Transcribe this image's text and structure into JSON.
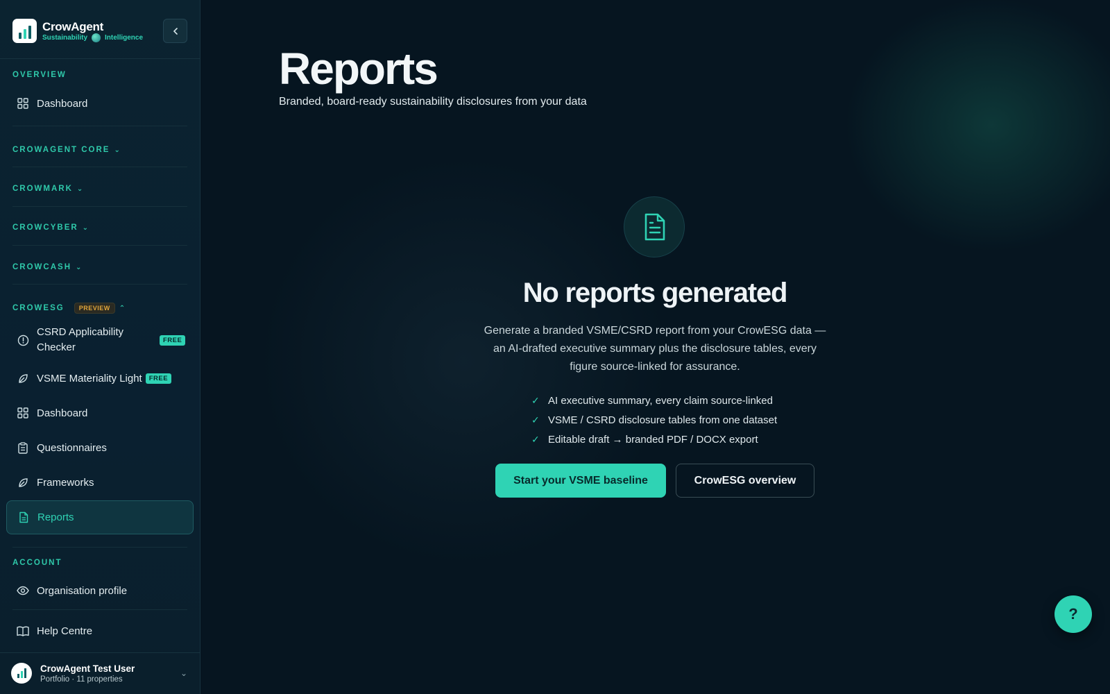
{
  "brand": {
    "name": "CrowAgent",
    "sub_left": "Sustainability",
    "sub_right": "Intelligence"
  },
  "sidebar": {
    "sections": {
      "overview": "OVERVIEW",
      "core": "CROWAGENT CORE",
      "mark": "CROWMARK",
      "cyber": "CROWCYBER",
      "cash": "CROWCASH",
      "esg": "CROWESG",
      "esg_badge": "PREVIEW",
      "account": "ACCOUNT"
    },
    "overview_dashboard": "Dashboard",
    "esg_items": {
      "csrd": "CSRD Applicability Checker",
      "csrd_badge": "FREE",
      "vsme": "VSME Materiality Light",
      "vsme_badge": "FREE",
      "dashboard": "Dashboard",
      "questionnaires": "Questionnaires",
      "frameworks": "Frameworks",
      "reports": "Reports"
    },
    "account_items": {
      "org": "Organisation profile",
      "help": "Help Centre"
    },
    "user": {
      "name": "CrowAgent Test User",
      "meta": "Portfolio · 11 properties"
    }
  },
  "main": {
    "title": "Reports",
    "subtitle": "Branded, board-ready sustainability disclosures from your data",
    "empty": {
      "title": "No reports generated",
      "description": "Generate a branded VSME/CSRD report from your CrowESG data — an AI-drafted executive summary plus the disclosure tables, every figure source-linked for assurance.",
      "features": [
        "AI executive summary, every claim source-linked",
        "VSME / CSRD disclosure tables from one dataset",
        "Editable draft → branded PDF / DOCX export"
      ],
      "primary_button": "Start your VSME baseline",
      "secondary_button": "CrowESG overview"
    },
    "help_fab": "?"
  },
  "colors": {
    "accent": "#2fd3b4",
    "background": "#061520",
    "sidebar": "#0b2330",
    "preview_badge": "#e0a63a"
  },
  "icons": {
    "dashboard": "grid-icon",
    "csrd": "alert-circle-icon",
    "vsme": "leaf-icon",
    "questionnaires": "clipboard-icon",
    "frameworks": "leaf-icon",
    "reports": "document-icon",
    "org": "eye-icon",
    "help": "book-icon"
  }
}
